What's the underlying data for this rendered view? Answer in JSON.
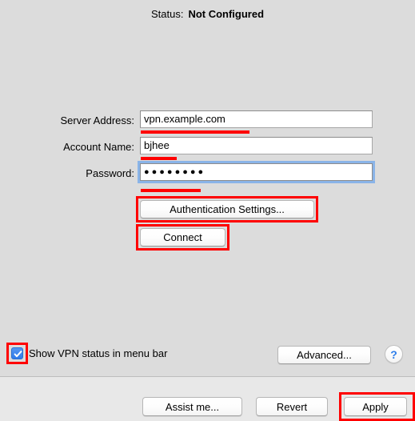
{
  "status": {
    "label": "Status:",
    "value": "Not Configured"
  },
  "form": {
    "server_address": {
      "label": "Server Address:",
      "value": "vpn.example.com",
      "placeholder": ""
    },
    "account_name": {
      "label": "Account Name:",
      "value": "bjhee",
      "placeholder": ""
    },
    "password": {
      "label": "Password:",
      "value": "●●●●●●●●",
      "placeholder": "",
      "focused": true
    }
  },
  "buttons": {
    "authentication_settings": "Authentication Settings...",
    "connect": "Connect",
    "advanced": "Advanced...",
    "assist_me": "Assist me...",
    "revert": "Revert",
    "apply": "Apply",
    "help": "?"
  },
  "checkbox": {
    "label": "Show VPN status in menu bar",
    "checked": true
  },
  "colors": {
    "background": "#dcdcdc",
    "bottom_bar": "#e8e8e8",
    "annotation_red": "#ff0000",
    "focus_blue": "#8ab4e8",
    "checkbox_blue": "#2f7aea",
    "help_blue": "#2d7dea"
  }
}
